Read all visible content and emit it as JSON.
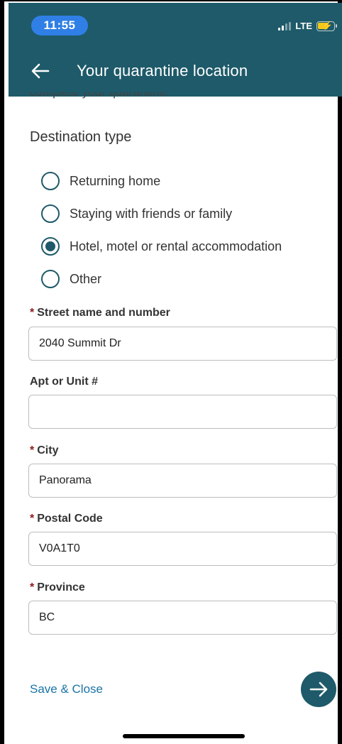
{
  "status_bar": {
    "time": "11:55",
    "network": "LTE",
    "icons": [
      "signal-icon",
      "battery-charging-icon"
    ]
  },
  "header": {
    "title": "Your quarantine location",
    "back_icon": "back-arrow-icon",
    "background_color": "#1e5a69"
  },
  "partial_text": "complete your quarantine.",
  "destination": {
    "title": "Destination type",
    "options": [
      {
        "label": "Returning home",
        "selected": false
      },
      {
        "label": "Staying with friends or family",
        "selected": false
      },
      {
        "label": "Hotel, motel or rental accommodation",
        "selected": true
      },
      {
        "label": "Other",
        "selected": false
      }
    ]
  },
  "fields": {
    "street": {
      "label": "Street name and number",
      "required": "*",
      "value": "2040 Summit Dr"
    },
    "apt": {
      "label": "Apt or Unit #",
      "value": ""
    },
    "city": {
      "label": "City",
      "required": "*",
      "value": "Panorama"
    },
    "postal": {
      "label": "Postal Code",
      "required": "*",
      "value": "V0A1T0"
    },
    "province": {
      "label": "Province",
      "required": "*",
      "value": "BC"
    }
  },
  "footer": {
    "save_close": "Save & Close",
    "next_icon": "arrow-right-icon"
  },
  "colors": {
    "accent": "#1e5a69",
    "link": "#1a73a6",
    "required": "#8b1a1a",
    "time_pill": "#2f7fe6"
  }
}
